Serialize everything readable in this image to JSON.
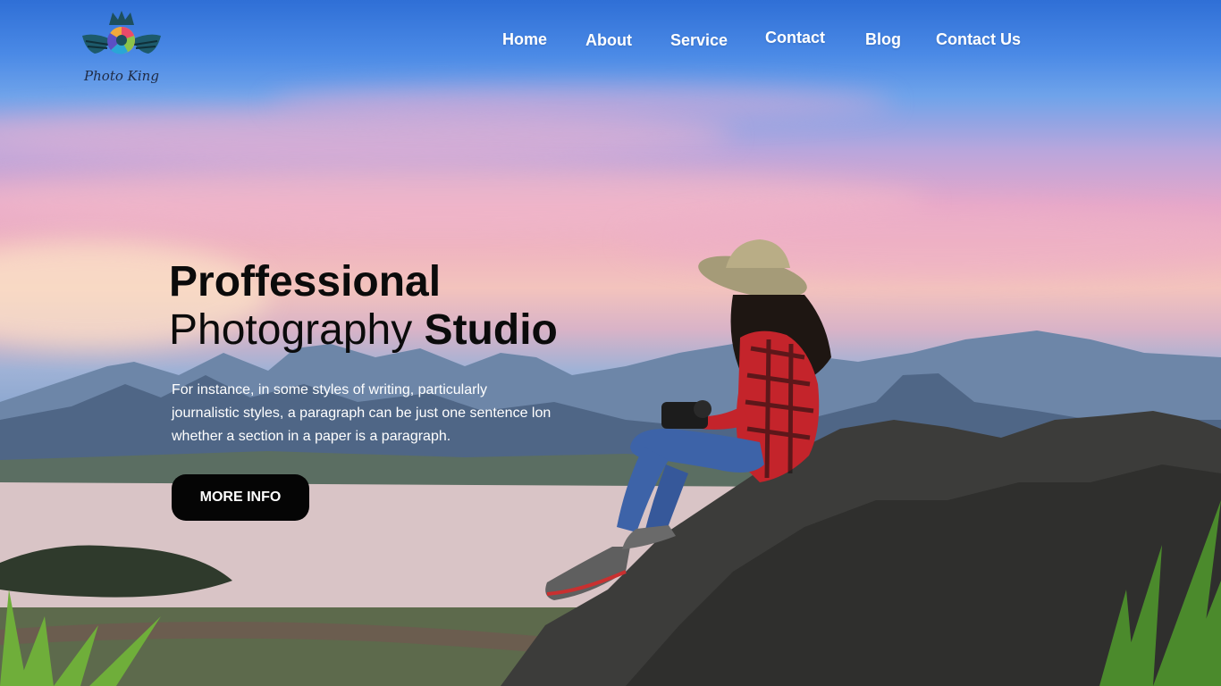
{
  "brand": {
    "name": "Photo King",
    "logo_icon": "crowned-aperture-wings-logo"
  },
  "nav": {
    "items": [
      {
        "label": "Home"
      },
      {
        "label": "About"
      },
      {
        "label": "Service"
      },
      {
        "label": "Contact"
      },
      {
        "label": "Blog"
      },
      {
        "label": "Contact Us"
      }
    ]
  },
  "hero": {
    "title_line1": "Proffessional",
    "title_line2_light": "Photography",
    "title_line2_bold": "Studio",
    "paragraph_line1": "For instance, in some styles of writing, particularly",
    "paragraph_line2": "journalistic styles, a paragraph can be just one sentence lon",
    "paragraph_line3": "whether a section in a paper is a paragraph.",
    "cta_label": "MORE INFO",
    "background_image": "woman-photographer-on-mountain-rock-at-sunset"
  },
  "colors": {
    "nav_text": "#ffffff",
    "headline": "#0b0b0b",
    "cta_background": "#050505",
    "cta_text": "#ffffff",
    "sky_top": "#2f6fd6",
    "sky_pink": "#efb4c0"
  }
}
